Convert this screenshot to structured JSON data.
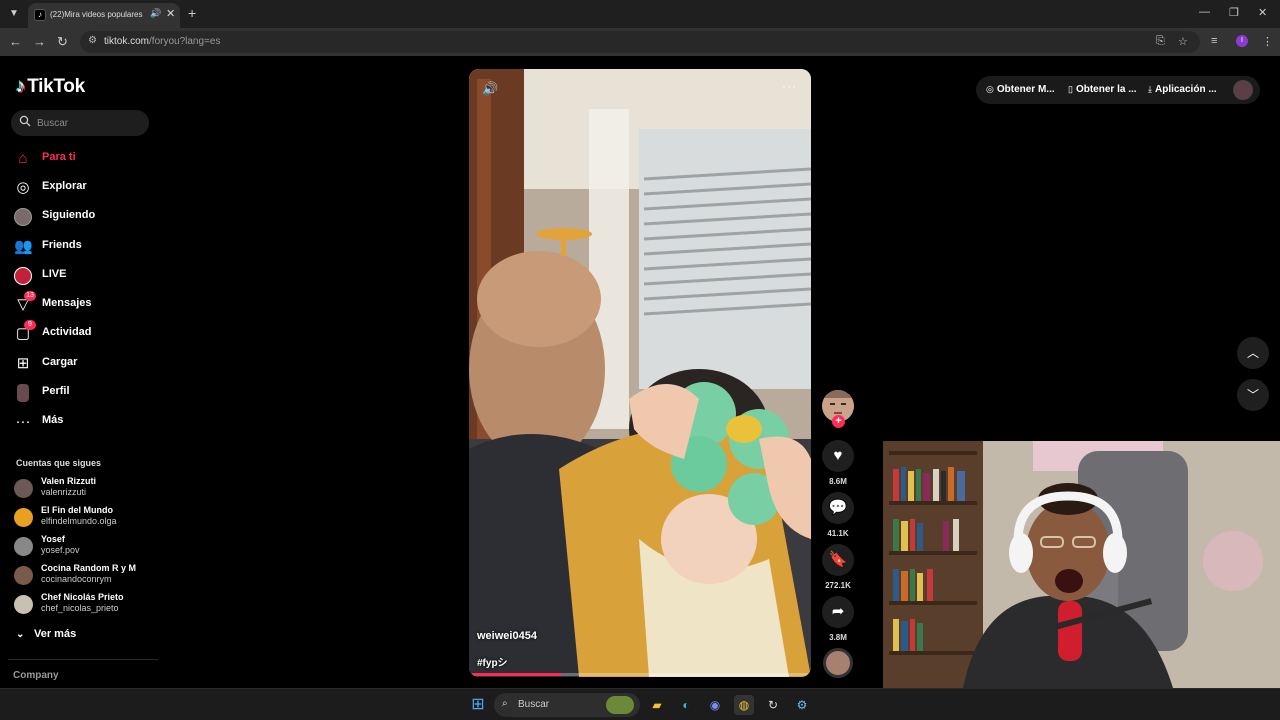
{
  "browser": {
    "tab_title": "(22)Mira videos populares",
    "url_host": "tiktok.com",
    "url_path": "/foryou?lang=es"
  },
  "sidebar": {
    "logo": "TikTok",
    "search_placeholder": "Buscar",
    "nav": [
      {
        "label": "Para ti",
        "icon": "home-icon",
        "active": true
      },
      {
        "label": "Explorar",
        "icon": "compass-icon"
      },
      {
        "label": "Siguiendo",
        "icon": "following-avatar-icon"
      },
      {
        "label": "Friends",
        "icon": "friends-icon"
      },
      {
        "label": "LIVE",
        "icon": "live-icon"
      },
      {
        "label": "Mensajes",
        "icon": "send-icon",
        "badge": "13"
      },
      {
        "label": "Actividad",
        "icon": "activity-icon",
        "badge": "9"
      },
      {
        "label": "Cargar",
        "icon": "upload-icon"
      },
      {
        "label": "Perfil",
        "icon": "profile-icon"
      },
      {
        "label": "Más",
        "icon": "more-icon"
      }
    ],
    "following_title": "Cuentas que sigues",
    "following": [
      {
        "name": "Valen Rizzuti",
        "user": "valenrizzuti",
        "color": "#6b5a54"
      },
      {
        "name": "El Fin del Mundo",
        "user": "elfindelmundo.olga",
        "color": "#e8a020"
      },
      {
        "name": "Yosef",
        "user": "yosef.pov",
        "color": "#888888"
      },
      {
        "name": "Cocina Random R y M",
        "user": "cocinandoconrym",
        "color": "#7a5a4a"
      },
      {
        "name": "Chef Nicolás Prieto",
        "user": "chef_nicolas_prieto",
        "color": "#c8c0b0"
      }
    ],
    "see_more": "Ver más",
    "company": "Company"
  },
  "topbar": {
    "btn1": "Obtener M...",
    "btn2": "Obtener la ...",
    "btn3": "Aplicación ..."
  },
  "video": {
    "username": "weiwei0454",
    "hashtag": "#fypシ",
    "progress": 0.27,
    "likes": "8.6M",
    "comments": "41.1K",
    "saves": "272.1K",
    "shares": "3.8M"
  },
  "taskbar": {
    "search_label": "Buscar"
  },
  "colors": {
    "accent": "#fe2c55",
    "bg": "#000000"
  }
}
